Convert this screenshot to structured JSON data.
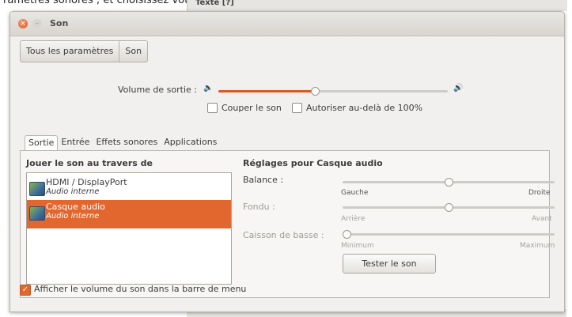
{
  "background": {
    "caption": "ramètres sonores ; et choisissez votre sortie son.",
    "tab_label": "Texte  [?]"
  },
  "window": {
    "title": "Son",
    "close_icon": "×",
    "minimize_icon": "–"
  },
  "breadcrumb": [
    "Tous les paramètres",
    "Son"
  ],
  "volume": {
    "label": "Volume de sortie :",
    "low_icon": "🔈",
    "high_icon": "🔊",
    "level": 0.42
  },
  "mute_label": "Couper le son",
  "amplify_label": "Autoriser au-delà de 100%",
  "tabs": [
    "Sortie",
    "Entrée",
    "Effets sonores",
    "Applications"
  ],
  "output": {
    "list_title": "Jouer le son au travers de",
    "devices": [
      {
        "name": "HDMI / DisplayPort",
        "sub": "Audio interne"
      },
      {
        "name": "Casque audio",
        "sub": "Audio interne"
      }
    ]
  },
  "settings": {
    "title": "Réglages pour Casque audio",
    "balance": {
      "label": "Balance :",
      "left": "Gauche",
      "right": "Droite",
      "value": 0.5
    },
    "fade": {
      "label": "Fondu :",
      "left": "Arrière",
      "right": "Avant",
      "value": 0.5
    },
    "subwoofer": {
      "label": "Caisson de basse :",
      "left": "Minimum",
      "right": "Maximum",
      "value": 0.0
    },
    "test_button": "Tester le son"
  },
  "menu_checkbox_label": "Afficher le volume du son dans la barre de menu",
  "accent_color": "#e2672e"
}
